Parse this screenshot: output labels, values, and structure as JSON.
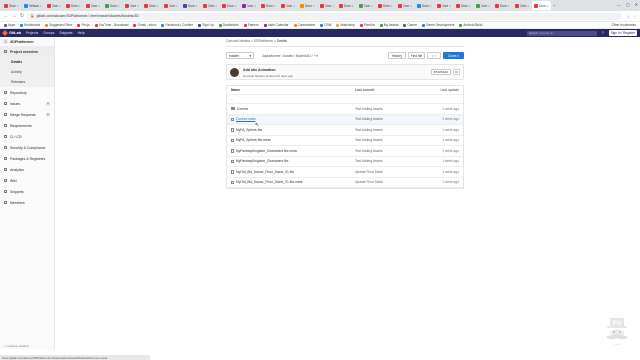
{
  "browser": {
    "tabs": [
      {
        "label": "Shor",
        "color": "#e53935"
      },
      {
        "label": "Refsanciou",
        "color": "#1e88e5"
      },
      {
        "label": "Dom",
        "color": "#e53935"
      },
      {
        "label": "Dom",
        "color": "#e53935"
      },
      {
        "label": "Dom",
        "color": "#e53935"
      },
      {
        "label": "Dom",
        "color": "#43a047"
      },
      {
        "label": "Dom",
        "color": "#e53935"
      },
      {
        "label": "Dom",
        "color": "#e53935"
      },
      {
        "label": "Dom",
        "color": "#e53935"
      },
      {
        "label": "Dom",
        "color": "#3949ab"
      },
      {
        "label": "Dom",
        "color": "#e53935"
      },
      {
        "label": "Dom",
        "color": "#e53935"
      },
      {
        "label": "Dom",
        "color": "#8e24aa"
      },
      {
        "label": "Dom",
        "color": "#e53935"
      },
      {
        "label": "Dom",
        "color": "#e53935"
      },
      {
        "label": "Dom",
        "color": "#fb8c00"
      },
      {
        "label": "Dom",
        "color": "#e53935"
      },
      {
        "label": "Dom",
        "color": "#e53935"
      },
      {
        "label": "Dom",
        "color": "#43a047"
      },
      {
        "label": "Dom",
        "color": "#e53935"
      },
      {
        "label": "Dom",
        "color": "#e53935"
      },
      {
        "label": "Dom",
        "color": "#1e88e5"
      },
      {
        "label": "Dom",
        "color": "#e53935"
      },
      {
        "label": "Dom",
        "color": "#e53935"
      },
      {
        "label": "Dom",
        "color": "#43a047"
      },
      {
        "label": "Dom",
        "color": "#e53935"
      },
      {
        "label": "Dom",
        "color": "#e53935"
      },
      {
        "label": "Dom",
        "color": "#e53935"
      }
    ],
    "active_tab_index": 27,
    "url": "gitlab.com/alcuser/3DPlatformer/-/tree/master/Assets/Models/3D",
    "bookmarks": [
      {
        "label": "Apps",
        "color": "#5f6368"
      },
      {
        "label": "Bookmarks",
        "color": "#1e88e5"
      },
      {
        "label": "Suggested Sites",
        "color": "#fb8c00"
      },
      {
        "label": "Pixi.js",
        "color": "#e53935"
      },
      {
        "label": "YouTube - Broadcast",
        "color": "#e53935"
      },
      {
        "label": "Gmail - Inbox",
        "color": "#e53935"
      },
      {
        "label": "Facebook | Confirm",
        "color": "#1e88e5"
      },
      {
        "label": "Sign Up",
        "color": "#3949ab"
      },
      {
        "label": "Doodlebots",
        "color": "#43a047"
      },
      {
        "label": "Patreon",
        "color": "#e53935"
      },
      {
        "label": "Indie Calendar",
        "color": "#8e24aa"
      },
      {
        "label": "Commander",
        "color": "#fb8c00"
      },
      {
        "label": "CRM",
        "color": "#1e88e5"
      },
      {
        "label": "Mailchimp",
        "color": "#f9a825"
      },
      {
        "label": "PixelArt",
        "color": "#e53935"
      },
      {
        "label": "My Assets",
        "color": "#43a047"
      },
      {
        "label": "Career",
        "color": "#5f6368"
      },
      {
        "label": "Game Development",
        "color": "#1e88e5"
      },
      {
        "label": "Android Build",
        "color": "#43a047"
      }
    ],
    "other_bookmarks": "Other bookmarks"
  },
  "gitlab": {
    "logo": "GitLab",
    "menu": [
      "Projects",
      "Groups",
      "Snippets",
      "Help"
    ],
    "search_placeholder": "Search or jump to...",
    "help": "?",
    "signin": "Sign in / Register"
  },
  "sidebar": {
    "project_initial": "3",
    "project_name": "3DPlatformer",
    "items": [
      {
        "label": "Project overview",
        "active": true,
        "count": ""
      },
      {
        "label": "Repository",
        "active": false,
        "count": ""
      },
      {
        "label": "Issues",
        "active": false,
        "count": "0"
      },
      {
        "label": "Merge Requests",
        "active": false,
        "count": "0"
      },
      {
        "label": "Requirements",
        "active": false,
        "count": ""
      },
      {
        "label": "CI / CD",
        "active": false,
        "count": ""
      },
      {
        "label": "Security & Compliance",
        "active": false,
        "count": ""
      },
      {
        "label": "Packages & Registries",
        "active": false,
        "count": ""
      },
      {
        "label": "Analytics",
        "active": false,
        "count": ""
      },
      {
        "label": "Wiki",
        "active": false,
        "count": ""
      },
      {
        "label": "Snippets",
        "active": false,
        "count": ""
      },
      {
        "label": "Members",
        "active": false,
        "count": ""
      }
    ],
    "subitems": [
      {
        "label": "Details",
        "active": true
      },
      {
        "label": "Activity",
        "active": false
      },
      {
        "label": "Releases",
        "active": false
      }
    ],
    "collapse": "« Collapse sidebar"
  },
  "main": {
    "breadcrumb": [
      "Gonzalo Medina",
      "3DPlatformer",
      "Details"
    ],
    "branch": "master",
    "path": [
      "3dplatformer",
      "Assets",
      "Models3D"
    ],
    "buttons": {
      "history": "History",
      "find_file": "Find file",
      "download": "⤓ ▾",
      "clone": "Clone ▾"
    },
    "commit": {
      "message": "Add Idle Animation",
      "author": "Gonzalo Medina",
      "time": "authored 6 days ago",
      "sha": "9f205820",
      "copy": "⧉"
    },
    "table": {
      "headers": {
        "name": "Name",
        "commit": "Last commit",
        "update": "Last update"
      },
      "up": "..",
      "rows": [
        {
          "name": "Convex",
          "type": "folder",
          "commit": "Test Adding Assets",
          "update": "1 week ago",
          "link": false,
          "hover": false
        },
        {
          "name": "Convex.meta",
          "type": "file",
          "commit": "Test Adding Assets",
          "update": "1 week ago",
          "link": true,
          "hover": true
        },
        {
          "name": "MyFA_Sphere.fbx",
          "type": "file",
          "commit": "Test Adding Assets",
          "update": "1 week ago",
          "link": false,
          "hover": false
        },
        {
          "name": "MyFA_Sphere.fbx.meta",
          "type": "file",
          "commit": "Test Adding Assets",
          "update": "1 week ago",
          "link": false,
          "hover": false
        },
        {
          "name": "MyFantasyKingdom_Characters.fbx.meta",
          "type": "file",
          "commit": "Test Adding Assets",
          "update": "1 week ago",
          "link": false,
          "hover": false
        },
        {
          "name": "MyFantasyKingdom_Characters.fbx",
          "type": "file",
          "commit": "Test Adding Assets",
          "update": "1 week ago",
          "link": false,
          "hover": false
        },
        {
          "name": "MyOld_Bld_House_Floor_Stone_01.fbx",
          "type": "file",
          "commit": "Update Floor Mesh",
          "update": "1 week ago",
          "link": false,
          "hover": false
        },
        {
          "name": "MyOld_Bld_House_Floor_Stone_01.fbx.meta",
          "type": "file",
          "commit": "Update Floor Mesh",
          "update": "1 week ago",
          "link": false,
          "hover": false
        }
      ]
    }
  },
  "statusbar": "https://gitlab.com/alcuser/3DPlatformer/-/blob/master/Assets/Models3D/Convex.meta",
  "watermark": "PG"
}
